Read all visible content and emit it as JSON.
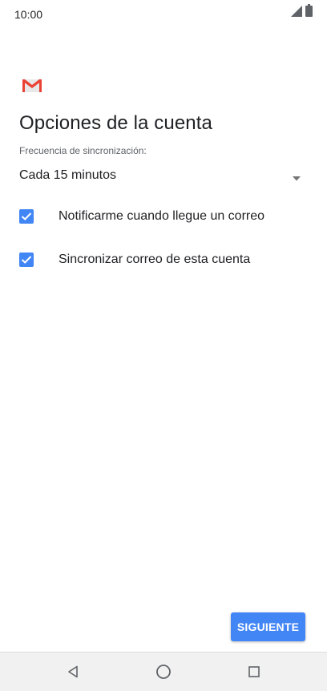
{
  "status_bar": {
    "time": "10:00"
  },
  "app": {
    "logo_icon": "gmail-m-logo",
    "colors": {
      "accent": "#4285f4",
      "logo_red": "#ea4335",
      "logo_gray": "#c5c5c5"
    }
  },
  "page": {
    "title": "Opciones de la cuenta"
  },
  "sync_frequency": {
    "label": "Frecuencia de sincronización:",
    "selected": "Cada 15 minutos"
  },
  "options": [
    {
      "label": "Notificarme cuando llegue un correo",
      "checked": true
    },
    {
      "label": "Sincronizar correo de esta cuenta",
      "checked": true
    }
  ],
  "footer": {
    "next_label": "SIGUIENTE"
  },
  "nav": {
    "icons": [
      "back-icon",
      "home-icon",
      "recents-icon"
    ]
  }
}
